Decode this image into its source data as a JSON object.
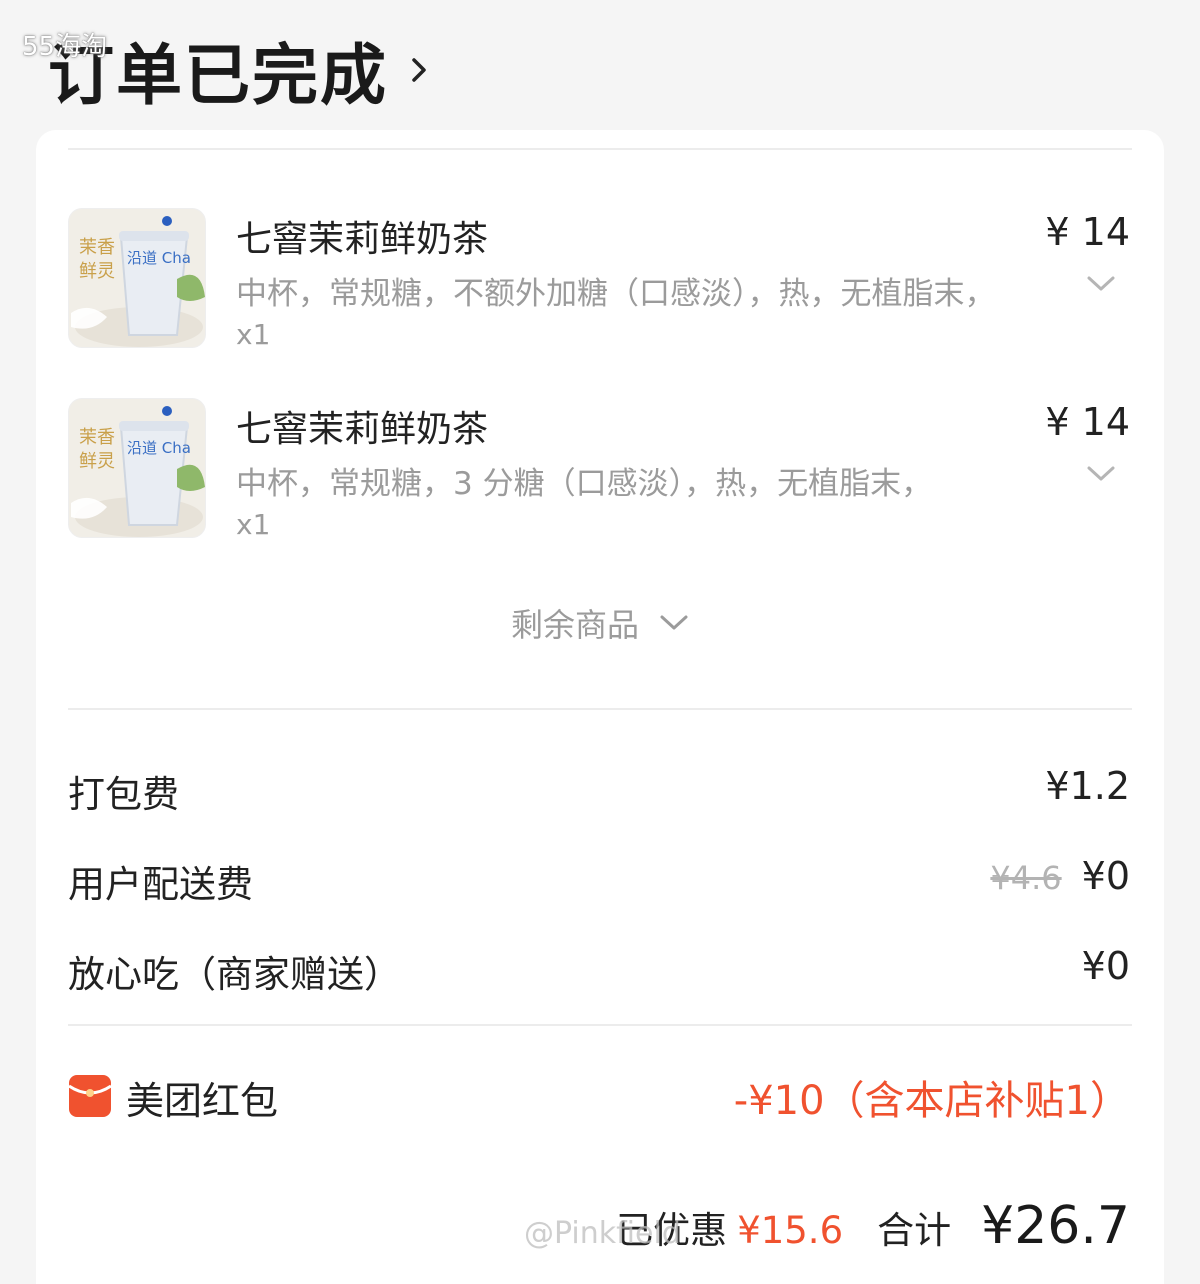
{
  "watermark_top": "55海淘",
  "watermark_bottom": "@Pinkfield",
  "header": {
    "title": "订单已完成",
    "chevron_icon": "chevron-right-icon"
  },
  "colors": {
    "accent_red": "#f0522f",
    "muted_text": "#9b9b9b",
    "card_bg": "#ffffff",
    "page_bg": "#f5f5f5"
  },
  "items": [
    {
      "name": "七窨茉莉鲜奶茶",
      "price": "¥ 14",
      "spec": "中杯，常规糖，不额外加糖（口感淡），热，无植脂末，",
      "qty": "x1",
      "thumb_text_a": "茉香",
      "thumb_text_b": "鲜灵",
      "thumb_brand": "沿道 Cha"
    },
    {
      "name": "七窨茉莉鲜奶茶",
      "price": "¥ 14",
      "spec": "中杯，常规糖，3 分糖（口感淡），热，无植脂末，",
      "qty": "x1",
      "thumb_text_a": "茉香",
      "thumb_text_b": "鲜灵",
      "thumb_brand": "沿道 Cha"
    }
  ],
  "more_items": {
    "label": "剩余商品"
  },
  "fees": {
    "packaging": {
      "label": "打包费",
      "value": "¥1.2"
    },
    "delivery": {
      "label": "用户配送费",
      "original": "¥4.6",
      "value": "¥0"
    },
    "insurance": {
      "label": "放心吃（商家赠送）",
      "value": "¥0"
    }
  },
  "red_packet": {
    "label": "美团红包",
    "value": "-¥10（含本店补贴1）"
  },
  "totals": {
    "saved_label": "已优惠",
    "saved_value": "¥15.6",
    "sum_label": "合计",
    "sum_value": "¥26.7"
  }
}
